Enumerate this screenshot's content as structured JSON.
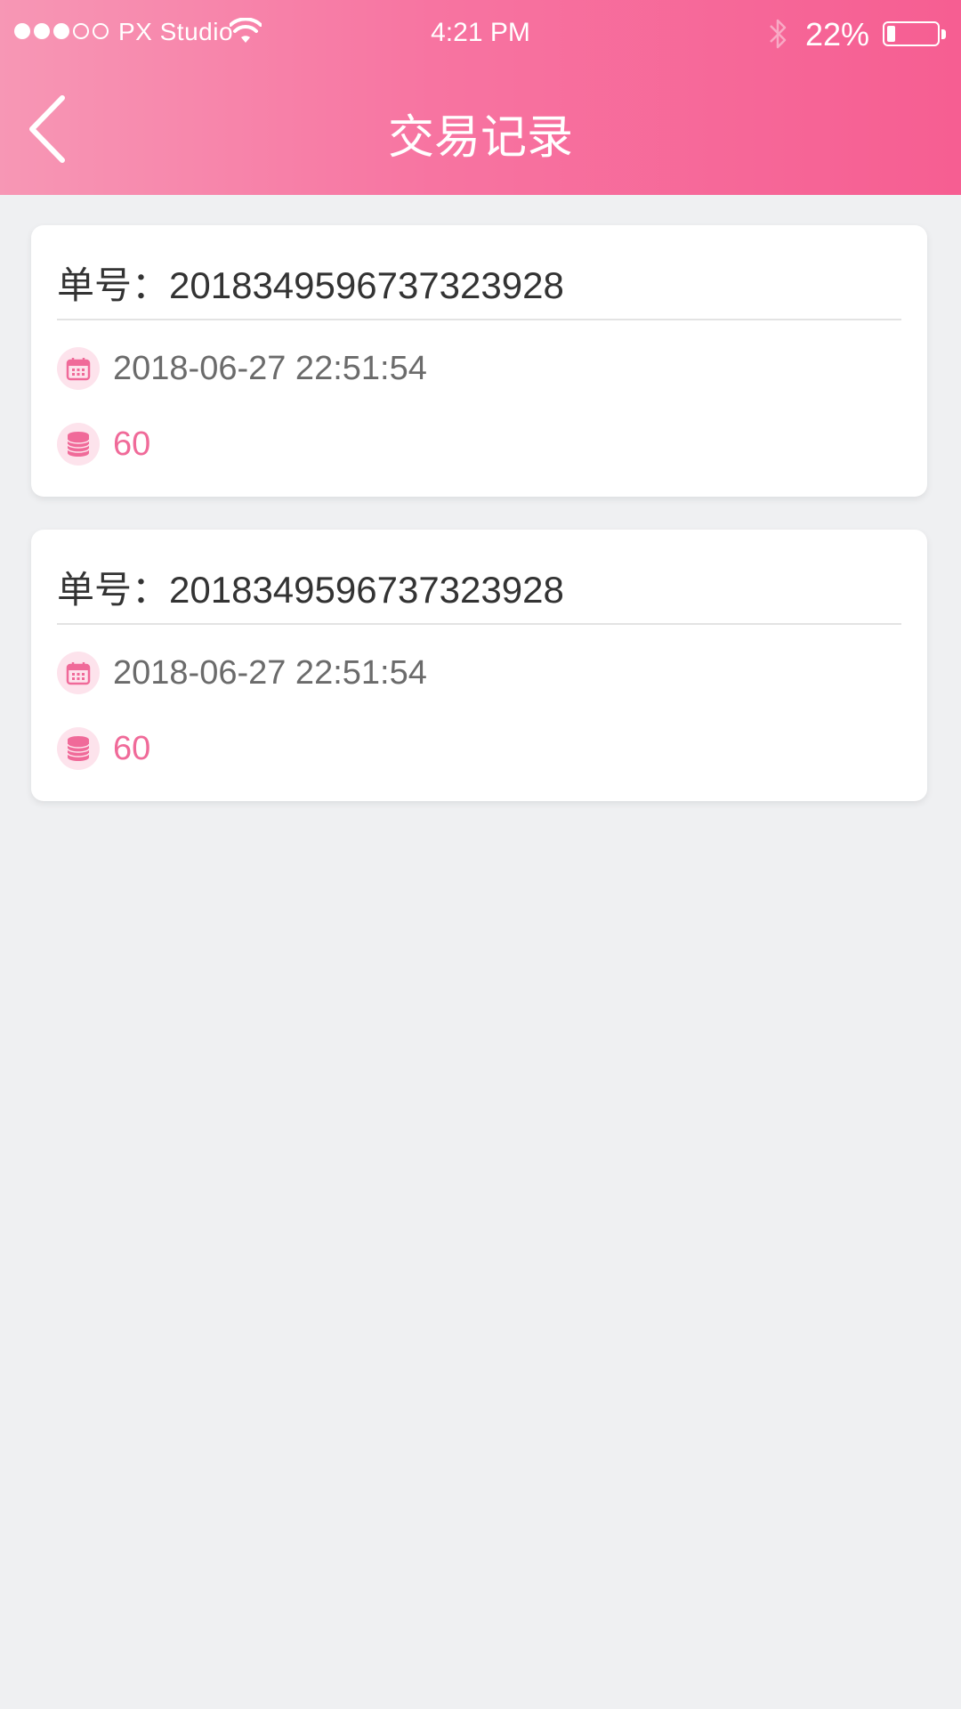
{
  "status_bar": {
    "carrier": "PX Studio",
    "time": "4:21 PM",
    "battery": "22%",
    "battery_level": 0.22,
    "signal_filled": 3,
    "signal_total": 5
  },
  "header": {
    "title": "交易记录",
    "back_icon": "chevron-left-icon"
  },
  "records": [
    {
      "order_label": "单号：",
      "order_number": "20183495967373239 28",
      "datetime": "2018-06-27 22:51:54",
      "amount": "60"
    },
    {
      "order_label": "单号：",
      "order_number": "2018349596737323928",
      "datetime": "2018-06-27 22:51:54",
      "amount": "60"
    }
  ],
  "colors": {
    "accent": "#f06a99",
    "header_start": "#f797b5",
    "header_end": "#f65e92",
    "background": "#eff0f2"
  },
  "icons": {
    "date": "calendar-icon",
    "amount": "coins-icon"
  }
}
